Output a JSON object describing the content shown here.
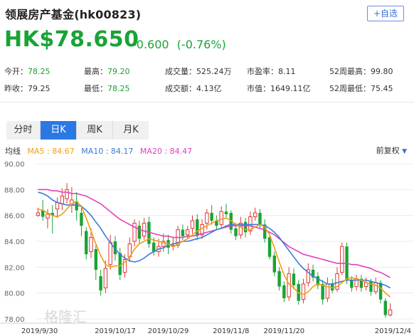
{
  "header": {
    "title": "领展房产基金(hk00823)",
    "add_label": "+自选"
  },
  "quote": {
    "price": "HK$78.650",
    "change": "-0.600",
    "change_pct": "(-0.76%)",
    "color_down": "#1aa335",
    "color_up": "#e03434"
  },
  "stats": {
    "row1": [
      {
        "label": "今开：",
        "value": "78.25",
        "color": "#1aa335"
      },
      {
        "label": "最高：",
        "value": "79.20",
        "color": "#1aa335"
      },
      {
        "label": "成交量：",
        "value": "525.24万",
        "color": "#333333"
      },
      {
        "label": "市盈率：",
        "value": "8.11",
        "color": "#333333"
      },
      {
        "label": "52周最高：",
        "value": "99.80",
        "color": "#333333"
      }
    ],
    "row2": [
      {
        "label": "昨收：",
        "value": "79.25",
        "color": "#333333"
      },
      {
        "label": "最低：",
        "value": "78.25",
        "color": "#1aa335"
      },
      {
        "label": "成交额：",
        "value": "4.13亿",
        "color": "#333333"
      },
      {
        "label": "市值：",
        "value": "1649.11亿",
        "color": "#333333"
      },
      {
        "label": "52周最低：",
        "value": "75.45",
        "color": "#333333"
      }
    ]
  },
  "tabs": [
    {
      "label": "分时",
      "active": false
    },
    {
      "label": "日K",
      "active": true
    },
    {
      "label": "周K",
      "active": false
    },
    {
      "label": "月K",
      "active": false
    }
  ],
  "ma_legend": {
    "prefix": "均线",
    "ma5": {
      "label": "MA5 : 84.67",
      "color": "#f39c12"
    },
    "ma10": {
      "label": "MA10 : 84.17",
      "color": "#3a7bd5"
    },
    "ma20": {
      "label": "MA20 : 84.47",
      "color": "#e040c0"
    },
    "adjust_label": "前复权"
  },
  "watermark": "格隆汇",
  "chart_data": {
    "type": "candlestick",
    "ylim": [
      78,
      90
    ],
    "y_ticks": [
      "90.00",
      "88.00",
      "86.00",
      "84.00",
      "82.00",
      "80.00",
      "78.00"
    ],
    "x_ticks": [
      "2019/9/30",
      "2019/10/17",
      "2019/10/29",
      "2019/11/8",
      "2019/11/20",
      "2019/12/4"
    ],
    "candles": [
      [
        86.0,
        86.2,
        86.6,
        85.9
      ],
      [
        86.4,
        85.9,
        87.2,
        85.6
      ],
      [
        85.8,
        86.1,
        86.5,
        85.0
      ],
      [
        86.2,
        86.0,
        86.8,
        84.6
      ],
      [
        86.5,
        87.0,
        87.4,
        85.8
      ],
      [
        86.9,
        87.5,
        88.1,
        86.4
      ],
      [
        87.3,
        88.0,
        88.5,
        86.9
      ],
      [
        86.8,
        87.2,
        88.2,
        86.2
      ],
      [
        87.1,
        86.4,
        87.8,
        85.6
      ],
      [
        86.2,
        85.2,
        86.8,
        84.4
      ],
      [
        84.8,
        83.0,
        85.1,
        82.6
      ],
      [
        83.2,
        84.3,
        85.0,
        82.7
      ],
      [
        83.4,
        81.8,
        83.7,
        81.0
      ],
      [
        81.3,
        80.2,
        81.8,
        79.8
      ],
      [
        80.4,
        81.9,
        82.5,
        80.0
      ],
      [
        82.2,
        83.9,
        84.5,
        81.8
      ],
      [
        84.0,
        83.0,
        84.4,
        82.5
      ],
      [
        83.1,
        81.4,
        83.5,
        81.0
      ],
      [
        81.6,
        82.6,
        83.0,
        81.2
      ],
      [
        82.8,
        83.8,
        84.3,
        82.4
      ],
      [
        84.0,
        85.4,
        85.7,
        83.6
      ],
      [
        85.2,
        84.2,
        85.6,
        83.8
      ],
      [
        84.4,
        85.4,
        85.8,
        84.1
      ],
      [
        85.5,
        83.8,
        85.9,
        83.5
      ],
      [
        83.9,
        83.2,
        84.3,
        82.9
      ],
      [
        83.2,
        83.6,
        84.2,
        82.8
      ],
      [
        83.6,
        84.0,
        84.6,
        83.2
      ],
      [
        84.1,
        83.5,
        84.5,
        83.0
      ],
      [
        83.6,
        83.7,
        84.3,
        83.3
      ],
      [
        83.7,
        84.9,
        85.2,
        83.5
      ],
      [
        84.9,
        84.4,
        85.3,
        84.1
      ],
      [
        84.5,
        84.9,
        85.2,
        84.2
      ],
      [
        85.0,
        85.6,
        86.0,
        84.6
      ],
      [
        85.7,
        84.4,
        86.1,
        84.1
      ],
      [
        84.5,
        85.3,
        85.7,
        84.2
      ],
      [
        85.4,
        86.2,
        86.5,
        84.9
      ],
      [
        86.2,
        85.6,
        86.8,
        85.3
      ],
      [
        85.6,
        85.2,
        86.0,
        84.9
      ],
      [
        85.3,
        86.3,
        86.7,
        85.0
      ],
      [
        86.3,
        86.1,
        86.9,
        85.8
      ],
      [
        86.2,
        84.9,
        86.4,
        84.6
      ],
      [
        85.0,
        84.4,
        85.4,
        84.1
      ],
      [
        84.5,
        85.4,
        85.9,
        84.2
      ],
      [
        85.5,
        84.7,
        85.8,
        84.3
      ],
      [
        84.8,
        85.9,
        86.3,
        84.5
      ],
      [
        85.9,
        86.2,
        86.6,
        85.6
      ],
      [
        86.2,
        85.3,
        86.5,
        85.0
      ],
      [
        85.3,
        84.2,
        85.7,
        83.9
      ],
      [
        84.3,
        82.8,
        84.6,
        82.6
      ],
      [
        82.9,
        81.6,
        83.2,
        81.3
      ],
      [
        81.7,
        80.5,
        82.0,
        80.2
      ],
      [
        80.6,
        79.6,
        80.9,
        79.3
      ],
      [
        79.7,
        81.5,
        82.0,
        79.4
      ],
      [
        81.5,
        80.6,
        81.9,
        80.3
      ],
      [
        80.7,
        79.4,
        81.0,
        79.1
      ],
      [
        79.5,
        80.7,
        81.1,
        79.2
      ],
      [
        80.8,
        81.8,
        82.3,
        80.5
      ],
      [
        81.8,
        81.2,
        82.2,
        80.9
      ],
      [
        81.3,
        80.6,
        81.6,
        80.3
      ],
      [
        80.7,
        79.5,
        81.0,
        79.1
      ],
      [
        79.6,
        80.7,
        81.2,
        79.3
      ],
      [
        80.7,
        80.2,
        81.1,
        80.0
      ],
      [
        80.3,
        81.5,
        82.0,
        80.1
      ],
      [
        81.6,
        83.6,
        83.9,
        81.4
      ],
      [
        83.6,
        81.0,
        83.9,
        80.7
      ],
      [
        81.0,
        80.4,
        81.3,
        80.1
      ],
      [
        80.5,
        81.1,
        81.4,
        80.2
      ],
      [
        81.1,
        80.4,
        81.4,
        80.1
      ],
      [
        80.5,
        80.8,
        81.2,
        80.2
      ],
      [
        80.9,
        80.1,
        81.1,
        79.8
      ],
      [
        80.1,
        80.8,
        81.2,
        79.9
      ],
      [
        80.8,
        79.5,
        81.0,
        79.2
      ],
      [
        79.4,
        78.3,
        79.6,
        78.1
      ],
      [
        78.3,
        78.7,
        79.2,
        78.2
      ]
    ],
    "ma5_values": [
      86.5,
      86.4,
      86.2,
      86.0,
      85.9,
      86.1,
      86.5,
      86.9,
      87.1,
      86.7,
      85.8,
      84.8,
      83.8,
      82.9,
      82.2,
      82.0,
      82.1,
      82.1,
      82.4,
      82.8,
      83.4,
      83.8,
      84.0,
      84.2,
      84.1,
      84.0,
      83.9,
      83.8,
      83.6,
      83.8,
      84.0,
      84.2,
      84.5,
      84.8,
      85.0,
      85.2,
      85.4,
      85.6,
      85.7,
      85.8,
      85.6,
      85.3,
      85.1,
      84.9,
      84.9,
      85.1,
      85.3,
      85.1,
      84.5,
      83.5,
      82.4,
      81.4,
      80.7,
      80.4,
      80.0,
      79.9,
      80.1,
      80.5,
      80.7,
      80.6,
      80.5,
      80.4,
      80.5,
      80.8,
      81.1,
      81.2,
      81.1,
      81.0,
      80.8,
      80.7,
      80.6,
      80.4,
      80.0,
      79.7
    ],
    "ma10_values": [
      87.8,
      87.7,
      87.5,
      87.2,
      87.0,
      86.9,
      86.8,
      86.8,
      86.8,
      86.7,
      86.4,
      86.0,
      85.5,
      85.0,
      84.4,
      83.9,
      83.4,
      83.0,
      82.7,
      82.5,
      82.4,
      82.5,
      82.7,
      83.0,
      83.2,
      83.4,
      83.5,
      83.7,
      83.8,
      83.9,
      84.0,
      84.0,
      84.1,
      84.2,
      84.3,
      84.5,
      84.7,
      84.9,
      85.0,
      85.2,
      85.3,
      85.3,
      85.3,
      85.3,
      85.3,
      85.3,
      85.3,
      85.2,
      85.0,
      84.7,
      84.3,
      83.8,
      83.3,
      82.8,
      82.3,
      81.9,
      81.6,
      81.3,
      81.1,
      80.9,
      80.7,
      80.7,
      80.8,
      80.9,
      81.0,
      81.0,
      81.0,
      81.0,
      81.0,
      80.9,
      80.8,
      80.7,
      80.6,
      80.4
    ],
    "ma20_values": [
      88.0,
      88.0,
      88.0,
      87.9,
      87.9,
      87.8,
      87.8,
      87.7,
      87.7,
      87.6,
      87.5,
      87.3,
      87.1,
      86.9,
      86.6,
      86.3,
      86.0,
      85.7,
      85.5,
      85.3,
      85.1,
      84.9,
      84.8,
      84.7,
      84.6,
      84.5,
      84.4,
      84.4,
      84.3,
      84.3,
      84.3,
      84.4,
      84.4,
      84.5,
      84.6,
      84.7,
      84.8,
      84.9,
      85.0,
      85.1,
      85.2,
      85.2,
      85.2,
      85.2,
      85.2,
      85.1,
      85.0,
      84.9,
      84.7,
      84.5,
      84.2,
      83.9,
      83.6,
      83.4,
      83.2,
      83.0,
      82.9,
      82.8,
      82.7,
      82.6,
      82.5,
      82.4,
      82.3,
      82.3,
      82.3,
      82.2,
      82.2,
      82.1,
      82.0,
      81.9,
      81.7,
      81.6,
      81.4,
      81.2
    ]
  }
}
